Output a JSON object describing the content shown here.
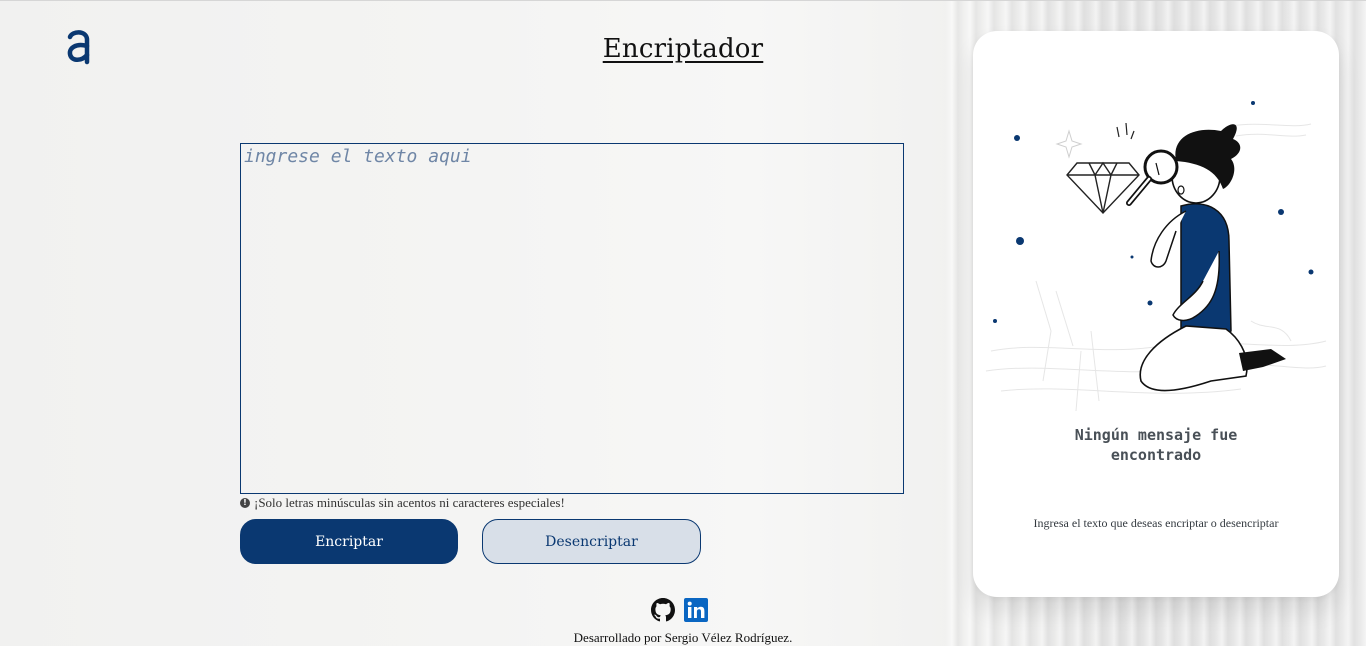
{
  "header": {
    "logo_icon": "alura-logo-icon",
    "title": "Encriptador"
  },
  "input": {
    "placeholder": "ingrese el texto aqui",
    "value": ""
  },
  "hint": {
    "icon": "exclamation-circle-icon",
    "text": "¡Solo letras minúsculas sin acentos ni caracteres especiales!"
  },
  "buttons": {
    "encrypt_label": "Encriptar",
    "decrypt_label": "Desencriptar"
  },
  "social": {
    "github_icon": "github-icon",
    "linkedin_icon": "linkedin-icon"
  },
  "footer": {
    "text": "Desarrollado por Sergio Vélez Rodríguez."
  },
  "output_panel": {
    "illustration": "person-with-magnifying-glass-illustration",
    "title": "Ningún mensaje fue encontrado",
    "subtitle": "Ingresa el texto que deseas encriptar o desencriptar"
  },
  "colors": {
    "primary": "#0a3871",
    "secondary_button_bg": "#d8dfe8",
    "panel_bg": "#ffffff",
    "page_bg": "#f3f3f2"
  }
}
